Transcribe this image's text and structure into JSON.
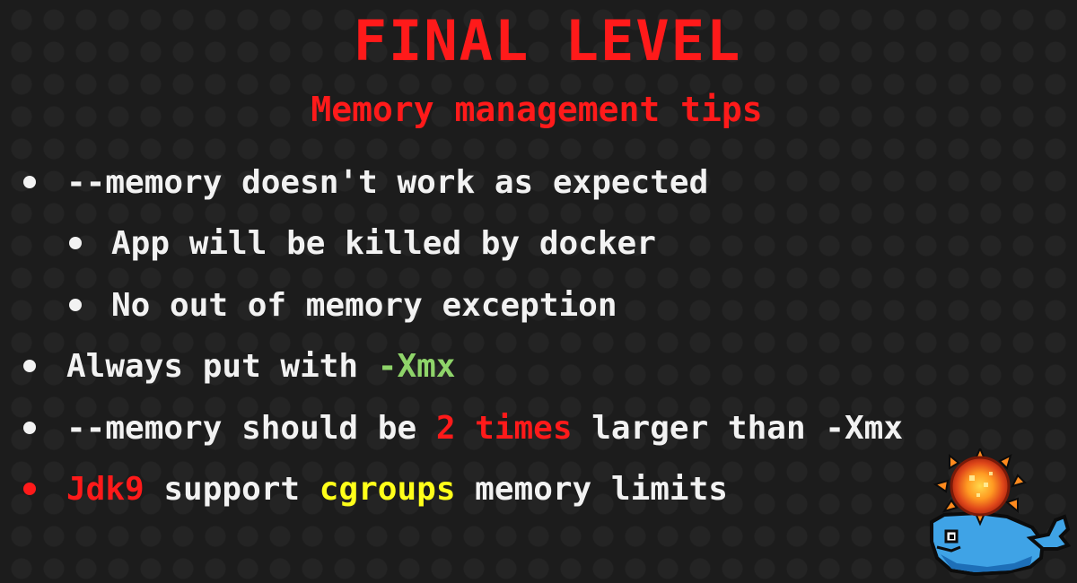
{
  "colors": {
    "background": "#1c1c1c",
    "title": "#ff1a1a",
    "subtitle": "#ff1a1a",
    "text": "#f2f2f2",
    "green": "#8fd46a",
    "red": "#ff1a1a",
    "yellow": "#ffff1a",
    "bullet": "#f2f2f2",
    "bullet_red": "#ff1a1a"
  },
  "slide": {
    "title": "FINAL LEVEL",
    "subtitle": "Memory management tips",
    "bullets": [
      {
        "level": 1,
        "bullet_color": "#f2f2f2",
        "segments": [
          {
            "text": "--memory doesn't work as expected",
            "color": "#f2f2f2"
          }
        ]
      },
      {
        "level": 2,
        "bullet_color": "#f2f2f2",
        "segments": [
          {
            "text": "App will be killed by docker",
            "color": "#f2f2f2"
          }
        ]
      },
      {
        "level": 2,
        "bullet_color": "#f2f2f2",
        "segments": [
          {
            "text": "No out of memory exception",
            "color": "#f2f2f2"
          }
        ]
      },
      {
        "level": 1,
        "bullet_color": "#f2f2f2",
        "segments": [
          {
            "text": "Always put with ",
            "color": "#f2f2f2"
          },
          {
            "text": "-Xmx",
            "color": "#8fd46a"
          }
        ]
      },
      {
        "level": 1,
        "bullet_color": "#f2f2f2",
        "segments": [
          {
            "text": "--memory should be ",
            "color": "#f2f2f2"
          },
          {
            "text": "2 times",
            "color": "#ff1a1a"
          },
          {
            "text": " larger than -Xmx",
            "color": "#f2f2f2"
          }
        ]
      },
      {
        "level": 1,
        "bullet_color": "#ff1a1a",
        "segments": [
          {
            "text": "Jdk9",
            "color": "#ff1a1a"
          },
          {
            "text": " support ",
            "color": "#f2f2f2"
          },
          {
            "text": "cgroups",
            "color": "#ffff1a"
          },
          {
            "text": " memory limits",
            "color": "#f2f2f2"
          }
        ]
      }
    ]
  },
  "mascot": {
    "icon": "pixel-whale-with-explosion-icon"
  }
}
